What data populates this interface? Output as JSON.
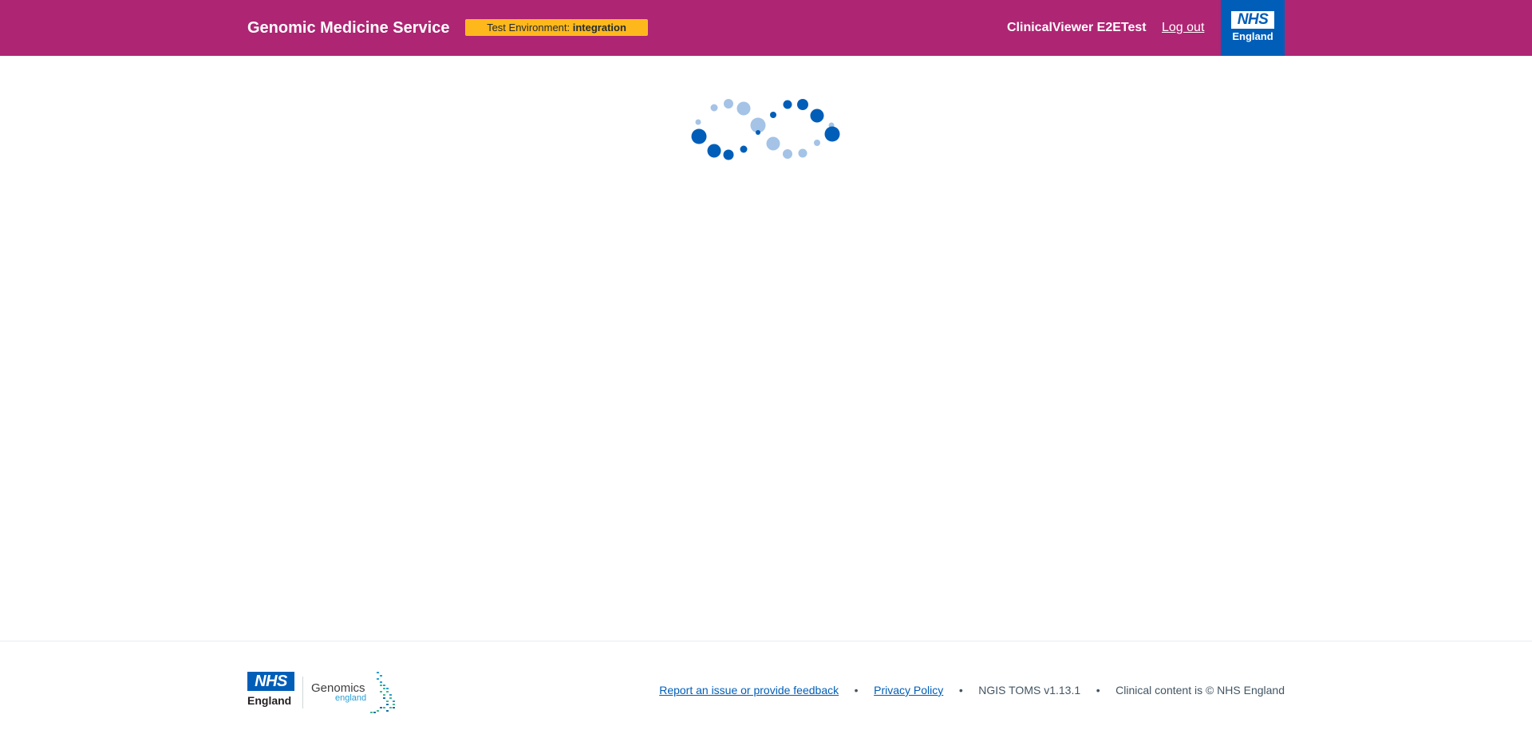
{
  "header": {
    "service_name": "Genomic Medicine Service",
    "environment_label": "Test Environment:",
    "environment_value": "integration",
    "user_name": "ClinicalViewer E2ETest",
    "logout_label": "Log out",
    "logo_text": "NHS",
    "logo_region": "England"
  },
  "main": {
    "loading_icon": "loading-spinner-icon"
  },
  "footer": {
    "nhs_logo_text": "NHS",
    "nhs_logo_region": "England",
    "genomics_logo_text": "Genomics",
    "genomics_logo_sub": "england",
    "links": {
      "report_issue": "Report an issue or provide feedback",
      "privacy_policy": "Privacy Policy"
    },
    "version": "NGIS TOMS v1.13.1",
    "copyright": "Clinical content is © NHS England",
    "separator": "•"
  },
  "colors": {
    "header_bg": "#ae2573",
    "nhs_blue": "#005eb8",
    "env_badge": "#ffb81c",
    "spinner_dark": "#005eb8",
    "spinner_light": "#a4c3e6"
  }
}
